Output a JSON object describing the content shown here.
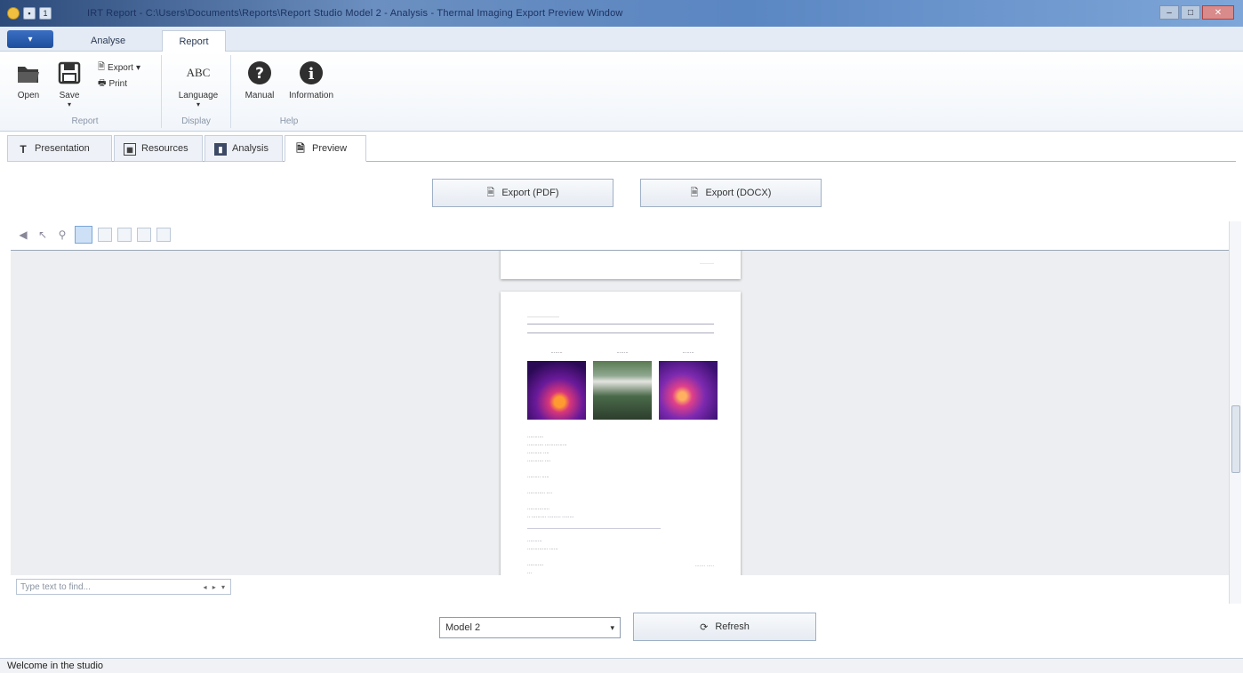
{
  "window": {
    "title": "IRT Report - C:\\Users\\Documents\\Reports\\Report Studio Model 2 - Analysis - Thermal Imaging Export Preview Window",
    "quick_access": [
      "1"
    ]
  },
  "ribbon": {
    "tabs": [
      "Analyse",
      "Report"
    ],
    "active_tab": "Report",
    "groups": {
      "report": {
        "label": "Report",
        "open": "Open",
        "save": "Save",
        "export": "Export",
        "print": "Print"
      },
      "display": {
        "label": "Display",
        "language_icon": "ABC",
        "language": "Language"
      },
      "help": {
        "label": "Help",
        "manual": "Manual",
        "information": "Information"
      }
    }
  },
  "content_tabs": [
    {
      "label": "Presentation",
      "icon": "text-icon"
    },
    {
      "label": "Resources",
      "icon": "image-icon"
    },
    {
      "label": "Analysis",
      "icon": "analysis-icon"
    },
    {
      "label": "Preview",
      "icon": "document-icon"
    }
  ],
  "export": {
    "pdf": "Export (PDF)",
    "docx": "Export (DOCX)"
  },
  "search": {
    "placeholder": "Type text to find...",
    "nav": "◂ ▸ ▾"
  },
  "bottom": {
    "model": "Model 2",
    "refresh": "Refresh"
  },
  "status": "Welcome in the studio",
  "colors": {
    "accent": "#3b6fc2",
    "titlebar": "#5a86c2"
  }
}
